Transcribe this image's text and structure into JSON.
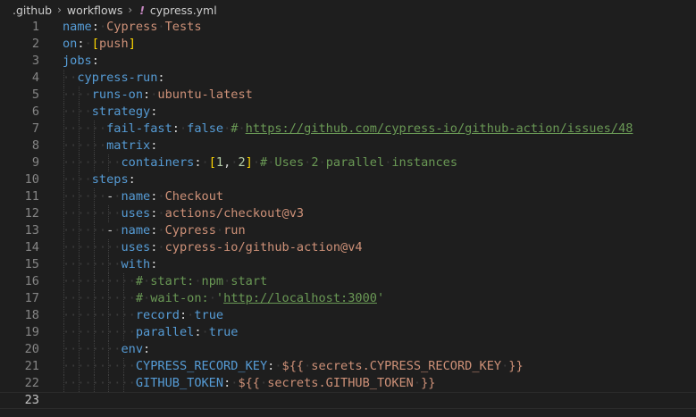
{
  "breadcrumb": {
    "parts": [
      ".github",
      "workflows"
    ],
    "file_icon": "!",
    "file": "cypress.yml",
    "separator_icon": "chevron-right-icon"
  },
  "editor": {
    "current_line": 23,
    "lines": [
      {
        "num": "1",
        "indent": 0,
        "tokens": [
          [
            "k",
            "name"
          ],
          [
            "p",
            ":"
          ],
          [
            "ws",
            "·"
          ],
          [
            "s",
            "Cypress"
          ],
          [
            "ws",
            "·"
          ],
          [
            "s",
            "Tests"
          ]
        ]
      },
      {
        "num": "2",
        "indent": 0,
        "tokens": [
          [
            "k",
            "on"
          ],
          [
            "p",
            ":"
          ],
          [
            "ws",
            "·"
          ],
          [
            "bt",
            "["
          ],
          [
            "s",
            "push"
          ],
          [
            "bt",
            "]"
          ]
        ]
      },
      {
        "num": "3",
        "indent": 0,
        "tokens": [
          [
            "k",
            "jobs"
          ],
          [
            "p",
            ":"
          ]
        ]
      },
      {
        "num": "4",
        "indent": 1,
        "tokens": [
          [
            "ws",
            "··"
          ],
          [
            "k",
            "cypress-run"
          ],
          [
            "p",
            ":"
          ]
        ]
      },
      {
        "num": "5",
        "indent": 2,
        "tokens": [
          [
            "ws",
            "····"
          ],
          [
            "k",
            "runs-on"
          ],
          [
            "p",
            ":"
          ],
          [
            "ws",
            "·"
          ],
          [
            "s",
            "ubuntu-latest"
          ]
        ]
      },
      {
        "num": "6",
        "indent": 2,
        "tokens": [
          [
            "ws",
            "····"
          ],
          [
            "k",
            "strategy"
          ],
          [
            "p",
            ":"
          ]
        ]
      },
      {
        "num": "7",
        "indent": 3,
        "tokens": [
          [
            "ws",
            "······"
          ],
          [
            "k",
            "fail-fast"
          ],
          [
            "p",
            ":"
          ],
          [
            "ws",
            "·"
          ],
          [
            "k",
            "false"
          ],
          [
            "ws",
            "·"
          ],
          [
            "c",
            "#"
          ],
          [
            "ws",
            "·"
          ],
          [
            "cu",
            "https://github.com/cypress-io/github-action/issues/48"
          ]
        ]
      },
      {
        "num": "8",
        "indent": 3,
        "tokens": [
          [
            "ws",
            "······"
          ],
          [
            "k",
            "matrix"
          ],
          [
            "p",
            ":"
          ]
        ]
      },
      {
        "num": "9",
        "indent": 4,
        "tokens": [
          [
            "ws",
            "········"
          ],
          [
            "k",
            "containers"
          ],
          [
            "p",
            ":"
          ],
          [
            "ws",
            "·"
          ],
          [
            "bt",
            "["
          ],
          [
            "n",
            "1"
          ],
          [
            "p",
            ","
          ],
          [
            "ws",
            "·"
          ],
          [
            "n",
            "2"
          ],
          [
            "bt",
            "]"
          ],
          [
            "ws",
            "·"
          ],
          [
            "c",
            "#"
          ],
          [
            "ws",
            "·"
          ],
          [
            "c",
            "Uses"
          ],
          [
            "ws",
            "·"
          ],
          [
            "c",
            "2"
          ],
          [
            "ws",
            "·"
          ],
          [
            "c",
            "parallel"
          ],
          [
            "ws",
            "·"
          ],
          [
            "c",
            "instances"
          ]
        ]
      },
      {
        "num": "10",
        "indent": 2,
        "tokens": [
          [
            "ws",
            "····"
          ],
          [
            "k",
            "steps"
          ],
          [
            "p",
            ":"
          ]
        ]
      },
      {
        "num": "11",
        "indent": 3,
        "tokens": [
          [
            "ws",
            "······"
          ],
          [
            "p",
            "-"
          ],
          [
            "ws",
            "·"
          ],
          [
            "k",
            "name"
          ],
          [
            "p",
            ":"
          ],
          [
            "ws",
            "·"
          ],
          [
            "s",
            "Checkout"
          ]
        ]
      },
      {
        "num": "12",
        "indent": 4,
        "tokens": [
          [
            "ws",
            "········"
          ],
          [
            "k",
            "uses"
          ],
          [
            "p",
            ":"
          ],
          [
            "ws",
            "·"
          ],
          [
            "s",
            "actions/checkout@v3"
          ]
        ]
      },
      {
        "num": "13",
        "indent": 3,
        "tokens": [
          [
            "ws",
            "······"
          ],
          [
            "p",
            "-"
          ],
          [
            "ws",
            "·"
          ],
          [
            "k",
            "name"
          ],
          [
            "p",
            ":"
          ],
          [
            "ws",
            "·"
          ],
          [
            "s",
            "Cypress"
          ],
          [
            "ws",
            "·"
          ],
          [
            "s",
            "run"
          ]
        ]
      },
      {
        "num": "14",
        "indent": 4,
        "tokens": [
          [
            "ws",
            "········"
          ],
          [
            "k",
            "uses"
          ],
          [
            "p",
            ":"
          ],
          [
            "ws",
            "·"
          ],
          [
            "s",
            "cypress-io/github-action@v4"
          ]
        ]
      },
      {
        "num": "15",
        "indent": 4,
        "tokens": [
          [
            "ws",
            "········"
          ],
          [
            "k",
            "with"
          ],
          [
            "p",
            ":"
          ]
        ]
      },
      {
        "num": "16",
        "indent": 5,
        "tokens": [
          [
            "ws",
            "··········"
          ],
          [
            "c",
            "#"
          ],
          [
            "ws",
            "·"
          ],
          [
            "c",
            "start:"
          ],
          [
            "ws",
            "·"
          ],
          [
            "c",
            "npm"
          ],
          [
            "ws",
            "·"
          ],
          [
            "c",
            "start"
          ]
        ]
      },
      {
        "num": "17",
        "indent": 5,
        "tokens": [
          [
            "ws",
            "··········"
          ],
          [
            "c",
            "#"
          ],
          [
            "ws",
            "·"
          ],
          [
            "c",
            "wait-on:"
          ],
          [
            "ws",
            "·"
          ],
          [
            "c",
            "'"
          ],
          [
            "cu",
            "http://localhost:3000"
          ],
          [
            "c",
            "'"
          ]
        ]
      },
      {
        "num": "18",
        "indent": 5,
        "tokens": [
          [
            "ws",
            "··········"
          ],
          [
            "k",
            "record"
          ],
          [
            "p",
            ":"
          ],
          [
            "ws",
            "·"
          ],
          [
            "k",
            "true"
          ]
        ]
      },
      {
        "num": "19",
        "indent": 5,
        "tokens": [
          [
            "ws",
            "··········"
          ],
          [
            "k",
            "parallel"
          ],
          [
            "p",
            ":"
          ],
          [
            "ws",
            "·"
          ],
          [
            "k",
            "true"
          ]
        ]
      },
      {
        "num": "20",
        "indent": 4,
        "tokens": [
          [
            "ws",
            "········"
          ],
          [
            "k",
            "env"
          ],
          [
            "p",
            ":"
          ]
        ]
      },
      {
        "num": "21",
        "indent": 5,
        "tokens": [
          [
            "ws",
            "··········"
          ],
          [
            "k",
            "CYPRESS_RECORD_KEY"
          ],
          [
            "p",
            ":"
          ],
          [
            "ws",
            "·"
          ],
          [
            "s",
            "${{"
          ],
          [
            "ws",
            "·"
          ],
          [
            "s",
            "secrets.CYPRESS_RECORD_KEY"
          ],
          [
            "ws",
            "·"
          ],
          [
            "s",
            "}}"
          ]
        ]
      },
      {
        "num": "22",
        "indent": 5,
        "tokens": [
          [
            "ws",
            "··········"
          ],
          [
            "k",
            "GITHUB_TOKEN"
          ],
          [
            "p",
            ":"
          ],
          [
            "ws",
            "·"
          ],
          [
            "s",
            "${{"
          ],
          [
            "ws",
            "·"
          ],
          [
            "s",
            "secrets.GITHUB_TOKEN"
          ],
          [
            "ws",
            "·"
          ],
          [
            "s",
            "}}"
          ]
        ]
      },
      {
        "num": "23",
        "indent": 0,
        "tokens": []
      }
    ]
  }
}
